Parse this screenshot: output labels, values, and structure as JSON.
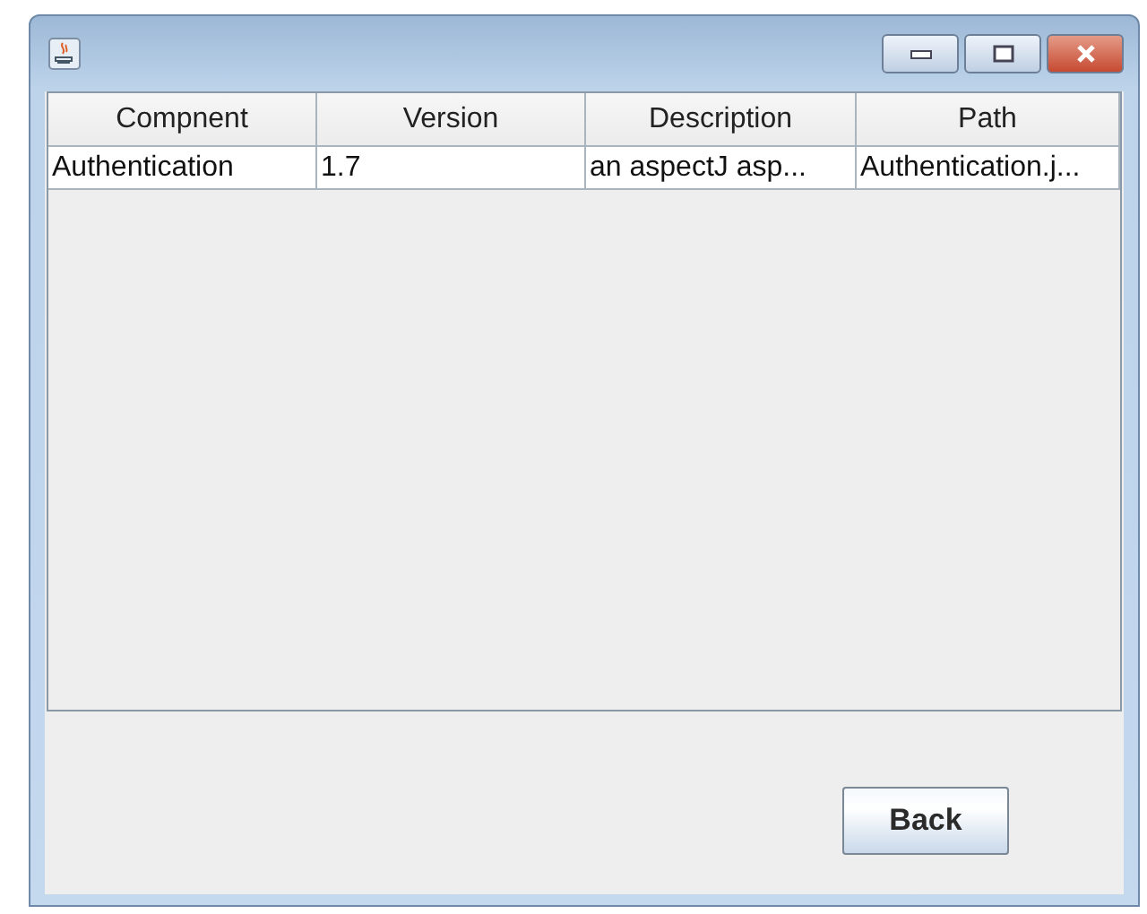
{
  "table": {
    "columns": [
      "Compnent",
      "Version",
      "Description",
      "Path"
    ],
    "rows": [
      [
        "Authentication",
        "1.7",
        "an aspectJ asp...",
        "Authentication.j..."
      ]
    ]
  },
  "buttons": [
    "Back"
  ]
}
